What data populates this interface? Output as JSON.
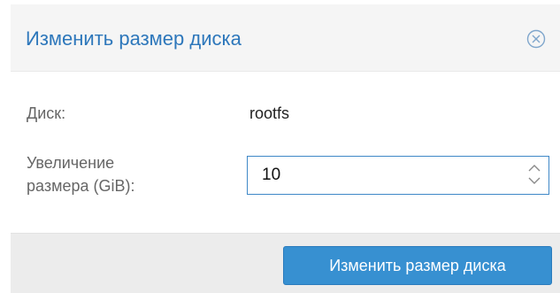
{
  "dialog": {
    "title": "Изменить размер диска",
    "close_icon": "circle-x-icon"
  },
  "form": {
    "disk_label": "Диск:",
    "disk_value": "rootfs",
    "increase_label_line1": "Увеличение",
    "increase_label_line2": "размера (GiB):",
    "increase_value": "10",
    "spinner_icon": "up-down-chevron-icon"
  },
  "footer": {
    "submit_label": "Изменить размер диска"
  },
  "colors": {
    "title": "#2d77bb",
    "accent": "#3790d1",
    "header_bg": "#f5f5f5",
    "footer_bg": "#ececec"
  }
}
